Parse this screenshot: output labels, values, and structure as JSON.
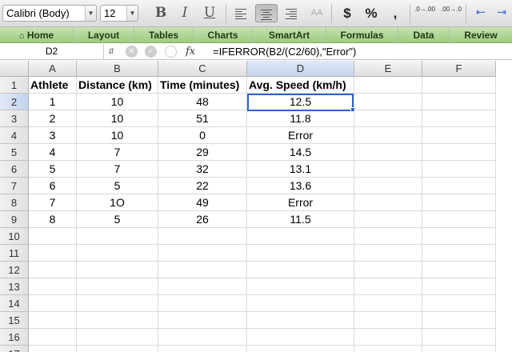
{
  "toolbar": {
    "font_name": "Calibri (Body)",
    "font_size": "12",
    "bold": "B",
    "italic": "I",
    "underline": "U",
    "clear_format": "AA",
    "currency": "$",
    "percent": "%",
    "comma": ",",
    "increase_decimal": ".0→.00",
    "decrease_decimal": ".00→.0"
  },
  "ribbon": {
    "tabs": [
      "Home",
      "Layout",
      "Tables",
      "Charts",
      "SmartArt",
      "Formulas",
      "Data",
      "Review"
    ]
  },
  "formula_bar": {
    "cell_ref": "D2",
    "fx": "fx",
    "formula": "=IFERROR(B2/(C2/60),\"Error\")"
  },
  "sheet": {
    "columns": [
      "A",
      "B",
      "C",
      "D",
      "E",
      "F"
    ],
    "row_numbers": [
      "1",
      "2",
      "3",
      "4",
      "5",
      "6",
      "7",
      "8",
      "9",
      "10",
      "11",
      "12",
      "13",
      "14",
      "15",
      "16",
      "17"
    ],
    "header": [
      "Athlete",
      "Distance (km)",
      "Time (minutes)",
      "Avg. Speed (km/h)"
    ],
    "rows": [
      [
        "1",
        "10",
        "48",
        "12.5"
      ],
      [
        "2",
        "10",
        "51",
        "11.8"
      ],
      [
        "3",
        "10",
        "0",
        "Error"
      ],
      [
        "4",
        "7",
        "29",
        "14.5"
      ],
      [
        "5",
        "7",
        "32",
        "13.1"
      ],
      [
        "6",
        "5",
        "22",
        "13.6"
      ],
      [
        "7",
        "1O",
        "49",
        "Error"
      ],
      [
        "8",
        "5",
        "26",
        "11.5"
      ]
    ],
    "selected_cell": "D2"
  },
  "colors": {
    "ribbon": "#9fcb83",
    "selection": "#2b63c9"
  }
}
